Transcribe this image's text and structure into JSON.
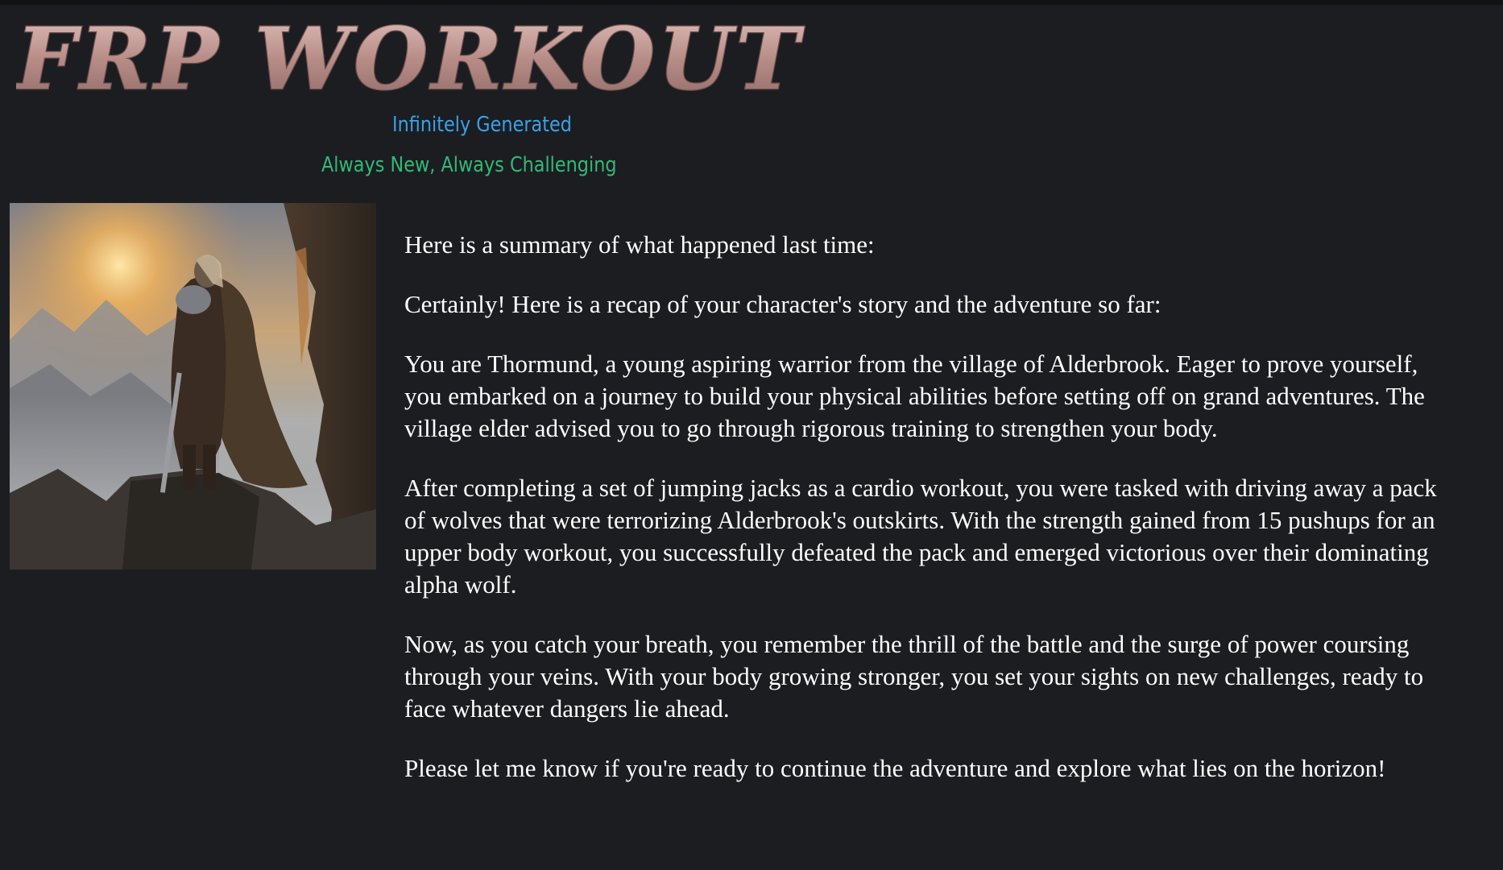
{
  "header": {
    "logo_text": "FRP WORKOUT",
    "tagline_primary": "Infinitely Generated",
    "tagline_secondary": "Always New, Always Challenging"
  },
  "hero_image": {
    "icon": "warrior-on-cliff-illustration"
  },
  "story": {
    "intro": "Here is a summary of what happened last time:",
    "paragraphs": [
      "Certainly! Here is a recap of your character's story and the adventure so far:",
      "You are Thormund, a young aspiring warrior from the village of Alderbrook. Eager to prove yourself, you embarked on a journey to build your physical abilities before setting off on grand adventures. The village elder advised you to go through rigorous training to strengthen your body.",
      "After completing a set of jumping jacks as a cardio workout, you were tasked with driving away a pack of wolves that were terrorizing Alderbrook's outskirts. With the strength gained from 15 pushups for an upper body workout, you successfully defeated the pack and emerged victorious over their dominating alpha wolf.",
      "Now, as you catch your breath, you remember the thrill of the battle and the surge of power coursing through your veins. With your body growing stronger, you set your sights on new challenges, ready to face whatever dangers lie ahead.",
      "Please let me know if you're ready to continue the adventure and explore what lies on the horizon!"
    ]
  },
  "colors": {
    "background": "#1c1d21",
    "tagline_primary": "#3ba1e6",
    "tagline_secondary": "#32b976",
    "logo_fill": "#c9a39e",
    "text": "#ffffff"
  }
}
